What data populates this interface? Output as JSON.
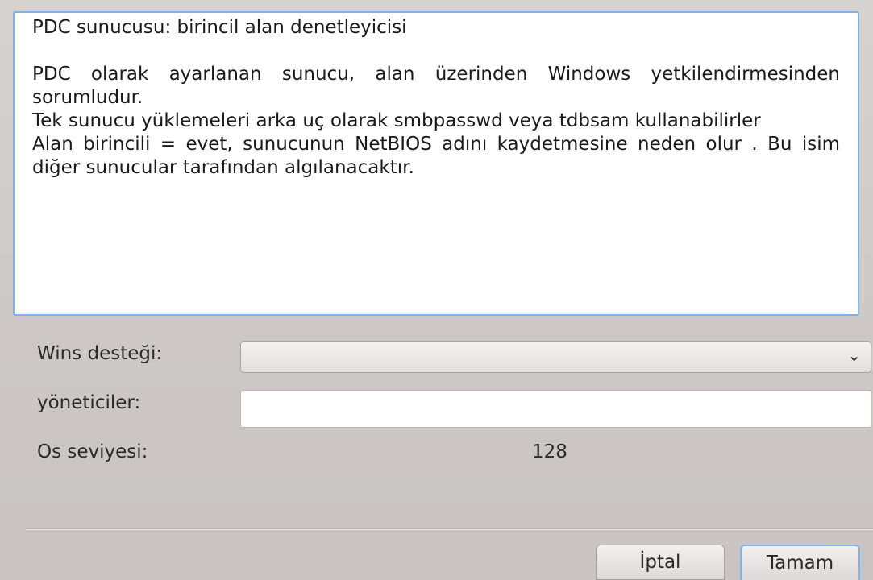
{
  "description": {
    "heading": "PDC sunucusu: birincil alan denetleyicisi",
    "paragraphs": [
      "PDC olarak ayarlanan sunucu, alan üzerinden Windows yetkilendirmesinden sorumludur.",
      "Tek sunucu yüklemeleri arka uç olarak smbpasswd veya tdbsam kullanabilirler",
      "Alan birincili = evet, sunucunun NetBIOS adını kaydetmesine neden olur . Bu isim diğer sunucular tarafından algılanacaktır."
    ]
  },
  "form": {
    "wins_label": "Wins desteği:",
    "wins_value": "",
    "admins_label": "yöneticiler:",
    "admins_value": "",
    "os_level_label": "Os seviyesi:",
    "os_level_value": "128"
  },
  "buttons": {
    "cancel": "İptal",
    "ok": "Tamam"
  },
  "colors": {
    "focus_border": "#7fb2e5",
    "window_bg": "#d6d2d0"
  }
}
